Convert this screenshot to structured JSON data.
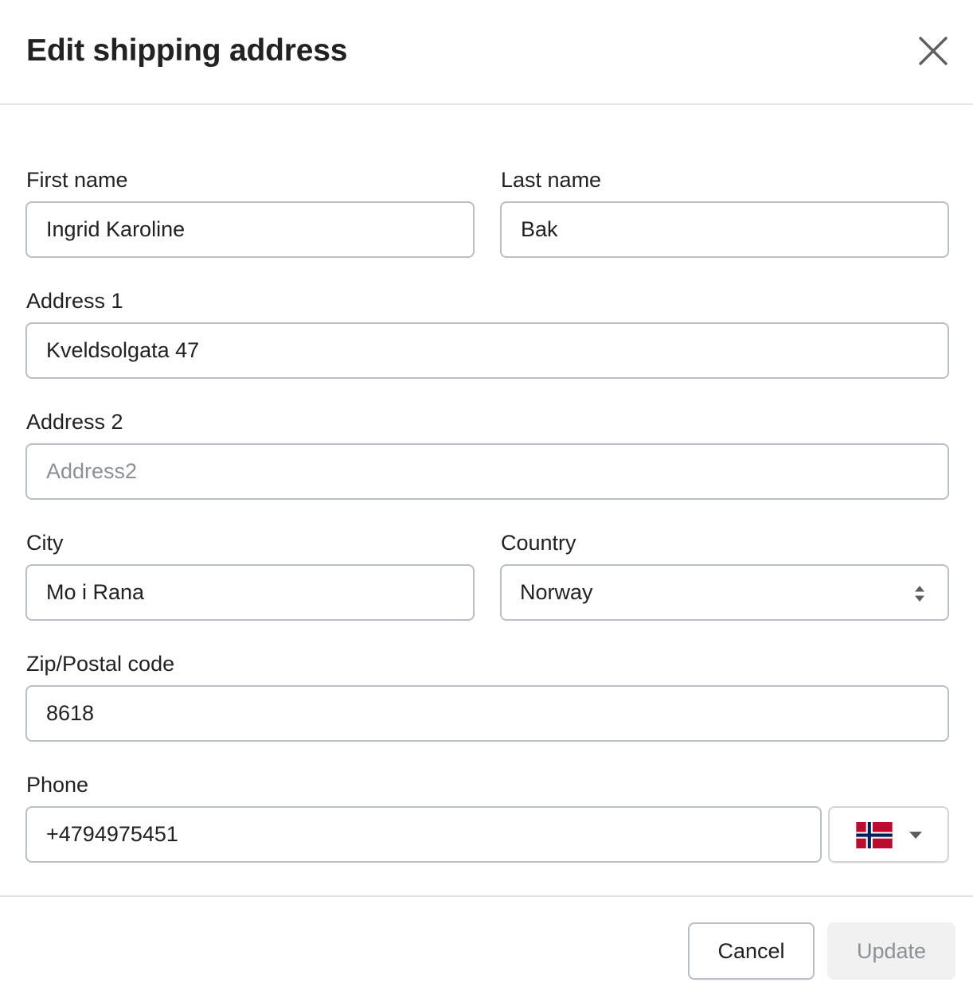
{
  "dialog": {
    "title": "Edit shipping address",
    "close_icon": "close-icon"
  },
  "form": {
    "first_name": {
      "label": "First name",
      "value": "Ingrid Karoline"
    },
    "last_name": {
      "label": "Last name",
      "value": "Bak"
    },
    "address1": {
      "label": "Address 1",
      "value": "Kveldsolgata 47"
    },
    "address2": {
      "label": "Address 2",
      "value": "",
      "placeholder": "Address2"
    },
    "city": {
      "label": "City",
      "value": "Mo i Rana"
    },
    "country": {
      "label": "Country",
      "value": "Norway",
      "icon": "select-updown-icon"
    },
    "zip": {
      "label": "Zip/Postal code",
      "value": "8618"
    },
    "phone": {
      "label": "Phone",
      "value": "+4794975451",
      "country_flag": "norway-flag-icon",
      "caret_icon": "caret-down-icon"
    }
  },
  "footer": {
    "cancel_label": "Cancel",
    "update_label": "Update"
  },
  "colors": {
    "text": "#202223",
    "border": "#babfc3",
    "disabled_bg": "#f1f1f1",
    "disabled_text": "#8c9196",
    "flag_red": "#ba0c2f",
    "flag_blue": "#00205b"
  }
}
